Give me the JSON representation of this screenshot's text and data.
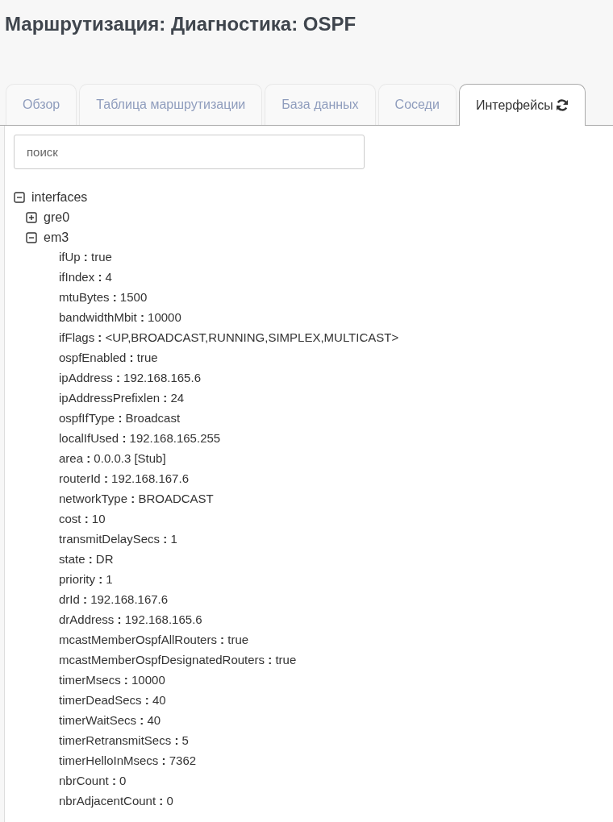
{
  "page": {
    "title": "Маршрутизация: Диагностика: OSPF"
  },
  "tabs": [
    {
      "label": "Обзор",
      "selected": false,
      "refresh": false
    },
    {
      "label": "Таблица маршрутизации",
      "selected": false,
      "refresh": false
    },
    {
      "label": "База данных",
      "selected": false,
      "refresh": false
    },
    {
      "label": "Соседи",
      "selected": false,
      "refresh": false
    },
    {
      "label": "Интерфейсы",
      "selected": true,
      "refresh": true
    }
  ],
  "search": {
    "placeholder": "поиск"
  },
  "tree": [
    {
      "kind": "node",
      "label": "interfaces",
      "expanded": true,
      "children": [
        {
          "kind": "node",
          "label": "gre0",
          "expanded": false
        },
        {
          "kind": "node",
          "label": "em3",
          "expanded": true,
          "children": [
            {
              "kind": "leaf",
              "text": "ifUp **:** true"
            },
            {
              "kind": "leaf",
              "text": "ifIndex **:** 4"
            },
            {
              "kind": "leaf",
              "text": "mtuBytes **:** 1500"
            },
            {
              "kind": "leaf",
              "text": "bandwidthMbit **:** 10000"
            },
            {
              "kind": "leaf",
              "text": "ifFlags **:** <UP,BROADCAST,RUNNING,SIMPLEX,MULTICAST>"
            },
            {
              "kind": "leaf",
              "text": "ospfEnabled **:** true"
            },
            {
              "kind": "leaf",
              "text": "ipAddress **:** 192.168.165.6"
            },
            {
              "kind": "leaf",
              "text": "ipAddressPrefixlen **:** 24"
            },
            {
              "kind": "leaf",
              "text": "ospfIfType **:** Broadcast"
            },
            {
              "kind": "leaf",
              "text": "localIfUsed **:** 192.168.165.255"
            },
            {
              "kind": "leaf",
              "text": "area **:** 0.0.0.3 [Stub]"
            },
            {
              "kind": "leaf",
              "text": "routerId **:** 192.168.167.6"
            },
            {
              "kind": "leaf",
              "text": "networkType **:** BROADCAST"
            },
            {
              "kind": "leaf",
              "text": "cost **:** 10"
            },
            {
              "kind": "leaf",
              "text": "transmitDelaySecs **:** 1"
            },
            {
              "kind": "leaf",
              "text": "state **:** DR"
            },
            {
              "kind": "leaf",
              "text": "priority **:** 1"
            },
            {
              "kind": "leaf",
              "text": "drId **:** 192.168.167.6"
            },
            {
              "kind": "leaf",
              "text": "drAddress **:** 192.168.165.6"
            },
            {
              "kind": "leaf",
              "text": "mcastMemberOspfAllRouters **:** true"
            },
            {
              "kind": "leaf",
              "text": "mcastMemberOspfDesignatedRouters **:** true"
            },
            {
              "kind": "leaf",
              "text": "timerMsecs **:** 10000"
            },
            {
              "kind": "leaf",
              "text": "timerDeadSecs **:** 40"
            },
            {
              "kind": "leaf",
              "text": "timerWaitSecs **:** 40"
            },
            {
              "kind": "leaf",
              "text": "timerRetransmitSecs **:** 5"
            },
            {
              "kind": "leaf",
              "text": "timerHelloInMsecs **:** 7362"
            },
            {
              "kind": "leaf",
              "text": "nbrCount **:** 0"
            },
            {
              "kind": "leaf",
              "text": "nbrAdjacentCount **:** 0"
            }
          ]
        }
      ]
    }
  ]
}
